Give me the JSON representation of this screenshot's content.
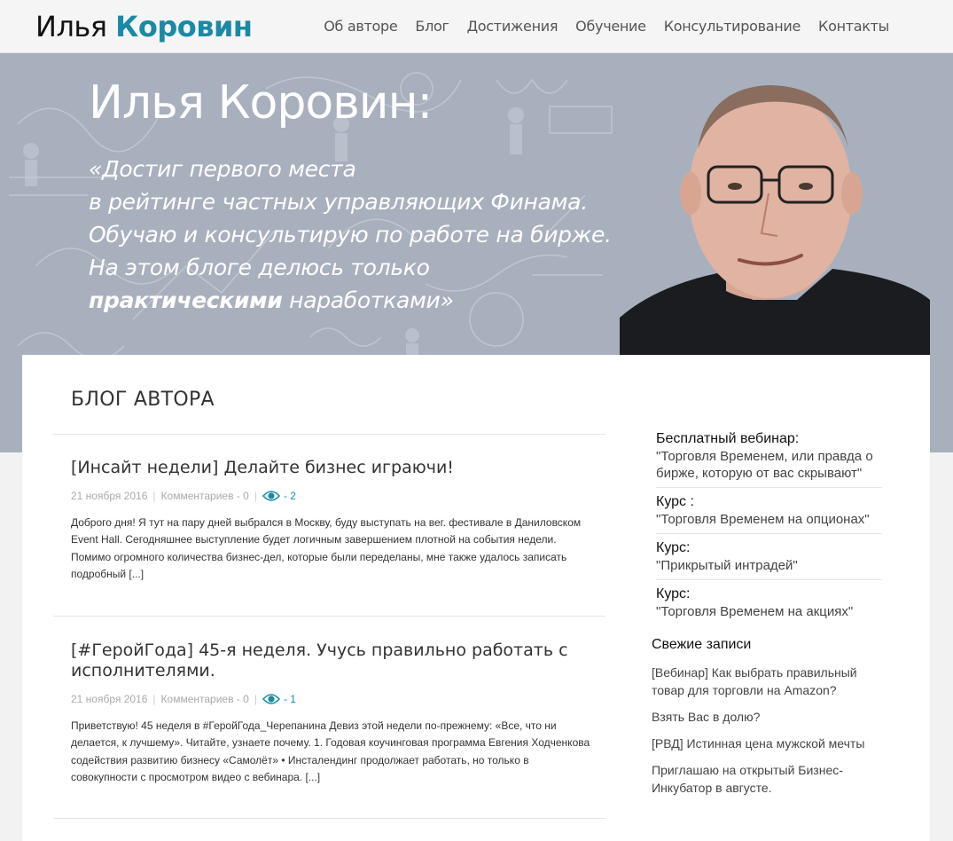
{
  "header": {
    "logo_first": "Илья",
    "logo_last": "Коровин",
    "nav": [
      "Об авторе",
      "Блог",
      "Достижения",
      "Обучение",
      "Консультирование",
      "Контакты"
    ]
  },
  "hero": {
    "title": "Илья Коровин:",
    "quote_lines": [
      "«Достиг первого места",
      "в рейтинге частных управляющих Финама.",
      "Обучаю и консультирую по работе на бирже.",
      "На этом блоге делюсь только"
    ],
    "quote_bold": "практическими",
    "quote_end": " наработками»"
  },
  "blog": {
    "heading": "БЛОГ АВТОРА",
    "posts": [
      {
        "title": "[Инсайт недели] Делайте бизнес играючи!",
        "date": "21 ноября 2016",
        "comments": "Комментариев - 0",
        "views": "- 2",
        "excerpt": "Доброго дня! Я тут на пару дней выбрался в Москву, буду выступать на вег. фестивале в Даниловском Event Hall. Сегодняшнее выступление будет логичным завершением плотной на события недели. Помимо огромного количества бизнес-дел, которые были переделаны, мне также удалось записать подробный [...]"
      },
      {
        "title": "[#ГеройГода] 45-я неделя. Учусь правильно работать с исполнителями.",
        "date": "21 ноября 2016",
        "comments": "Комментариев - 0",
        "views": "- 1",
        "excerpt": "Приветствую! 45 неделя в #ГеройГода_Черепанина Девиз этой недели по-прежнему: «Все, что ни делается, к лучшему». Читайте, узнаете почему. 1. Годовая коучинговая программа Евгения Ходченкова содействия развитию бизнесу «Самолёт» • Инсталендинг продолжает работать, но только в совокупности с просмотром видео с вебинара. [...]"
      }
    ]
  },
  "sidebar": {
    "promos": [
      {
        "label": "Бесплатный вебинар:",
        "link": "\"Торговля Временем, или правда о бирже, которую от вас скрывают\""
      },
      {
        "label": "Курс :",
        "link": "\"Торговля Временем на опционах\""
      },
      {
        "label": "Курс:",
        "link": "\"Прикрытый интрадей\""
      },
      {
        "label": "Курс:",
        "link": "\"Торговля Временем на акциях\""
      }
    ],
    "recent_heading": "Свежие записи",
    "recent": [
      "[Вебинар] Как выбрать правильный товар для торговли на Amazon?",
      "Взять Вас в долю?",
      "[РВД] Истинная цена мужской мечты",
      "Приглашаю на открытый Бизнес-Инкубатор в августе."
    ]
  },
  "colors": {
    "accent": "#1a8aa6",
    "hero_bg": "#a9b0bd"
  }
}
